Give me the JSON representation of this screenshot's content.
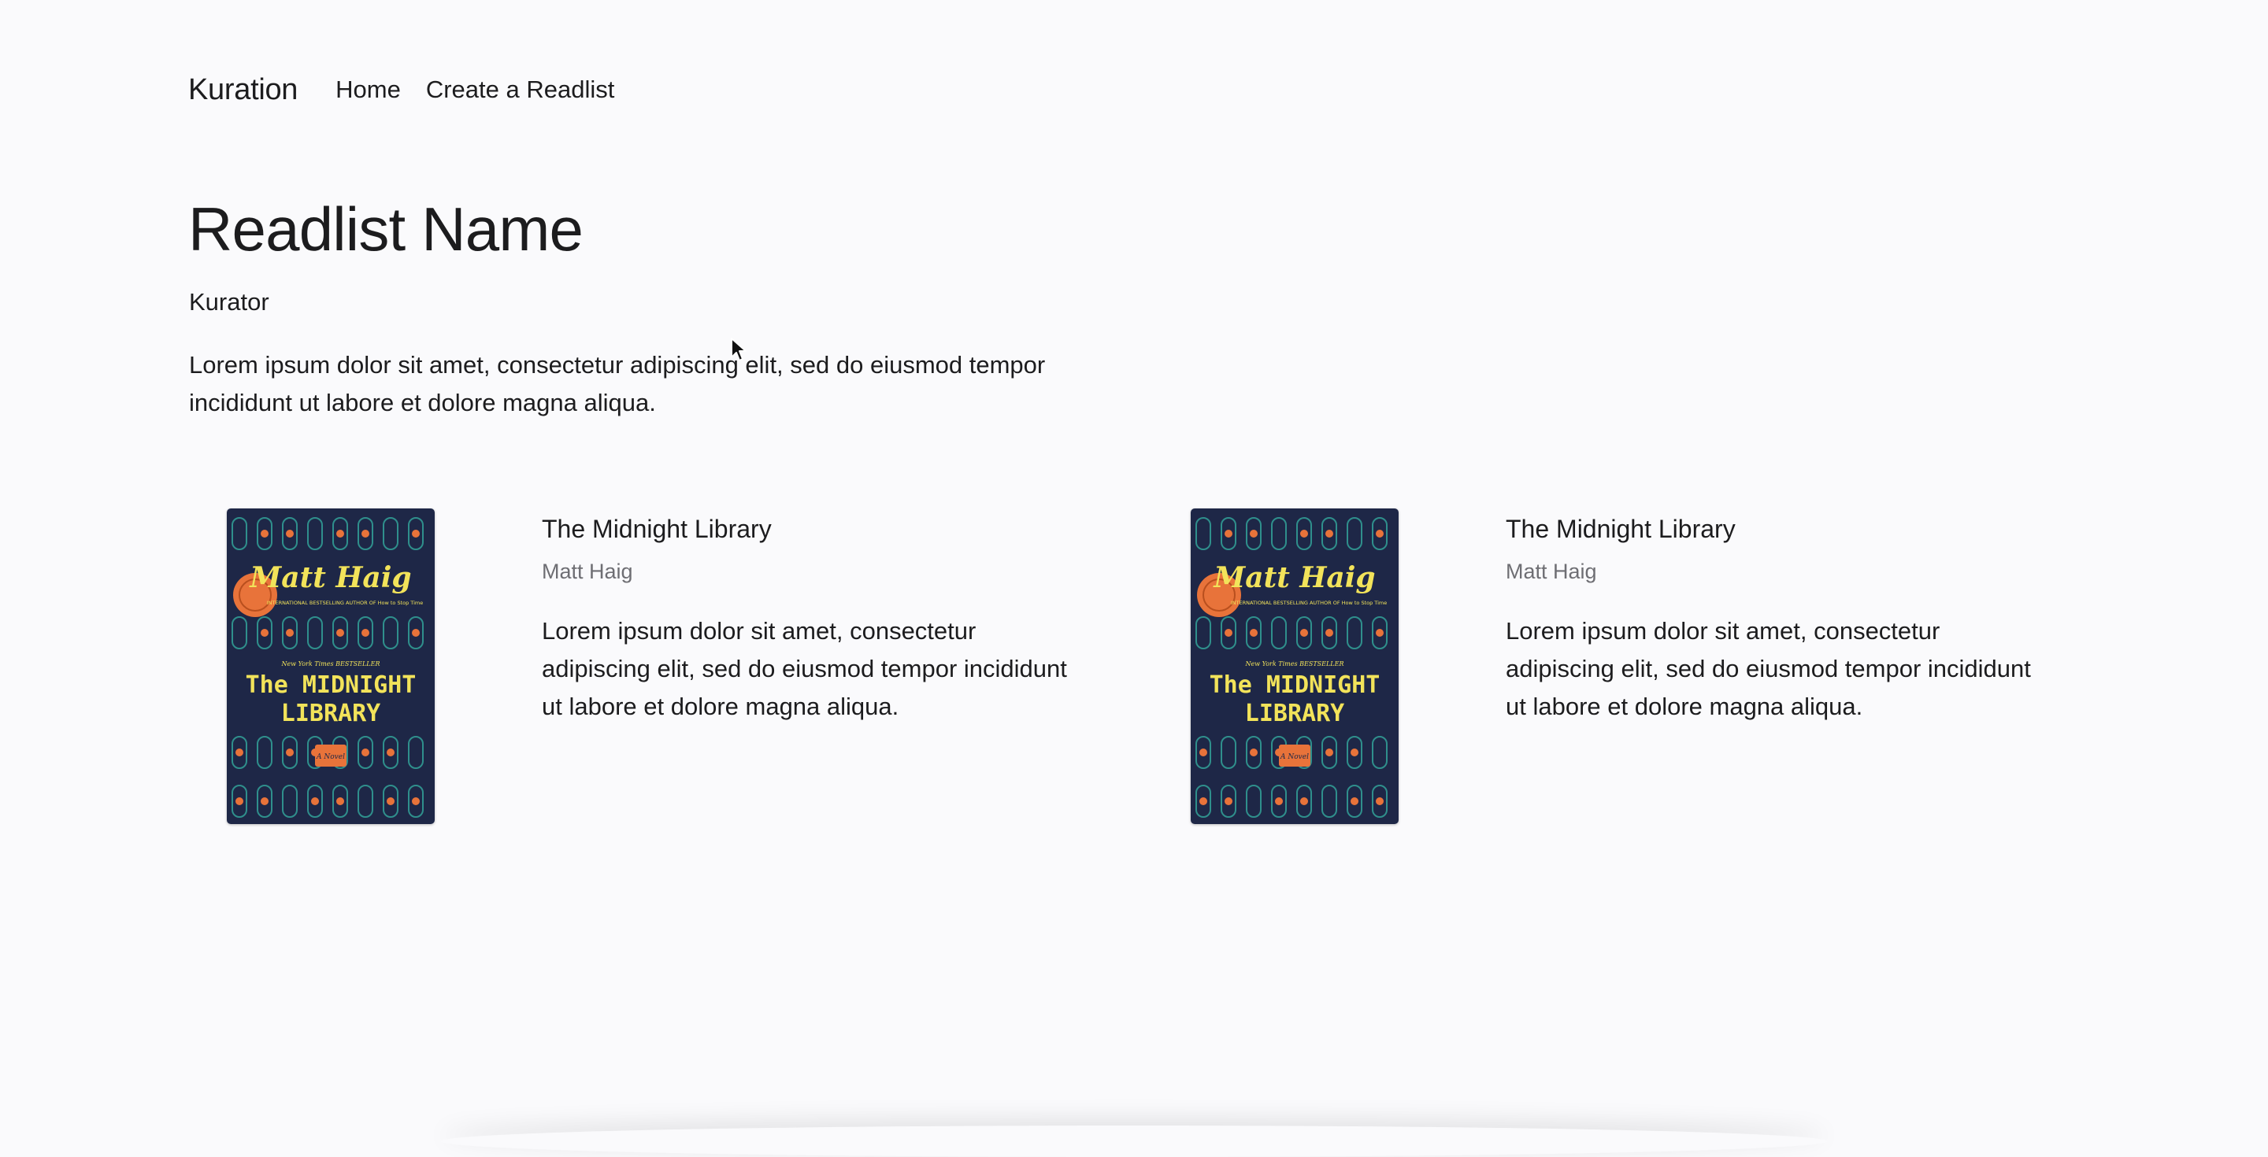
{
  "nav": {
    "brand": "Kuration",
    "links": [
      "Home",
      "Create a Readlist"
    ]
  },
  "readlist": {
    "name": "Readlist Name",
    "curator": "Kurator",
    "description": "Lorem ipsum dolor sit amet, consectetur adipiscing elit, sed do eiusmod tempor incididunt ut labore et dolore magna aliqua."
  },
  "books": [
    {
      "title": "The Midnight Library",
      "author": "Matt Haig",
      "description": "Lorem ipsum dolor sit amet, consectetur adipiscing elit, sed do eiusmod tempor incididunt ut labore et dolore magna aliqua.",
      "cover": {
        "author_text": "Matt Haig",
        "tagline": "INTERNATIONAL BESTSELLING AUTHOR OF How to Stop Time",
        "badge": "New York Times BESTSELLER",
        "title_line1": "The MIDNIGHT",
        "title_line2": "LIBRARY",
        "subtitle": "A Novel"
      }
    },
    {
      "title": "The Midnight Library",
      "author": "Matt Haig",
      "description": "Lorem ipsum dolor sit amet, consectetur adipiscing elit, sed do eiusmod tempor incididunt ut labore et dolore magna aliqua.",
      "cover": {
        "author_text": "Matt Haig",
        "tagline": "INTERNATIONAL BESTSELLING AUTHOR OF How to Stop Time",
        "badge": "New York Times BESTSELLER",
        "title_line1": "The MIDNIGHT",
        "title_line2": "LIBRARY",
        "subtitle": "A Novel"
      }
    }
  ],
  "colors": {
    "background": "#fafafc",
    "text": "#1c1c1e",
    "muted": "#6e6e73",
    "cover_navy": "#1e2747",
    "cover_orange": "#e8733a",
    "cover_yellow": "#f2e35a",
    "cover_teal": "#2f8f8c"
  },
  "icons": {
    "cursor": "mouse-pointer-icon"
  }
}
